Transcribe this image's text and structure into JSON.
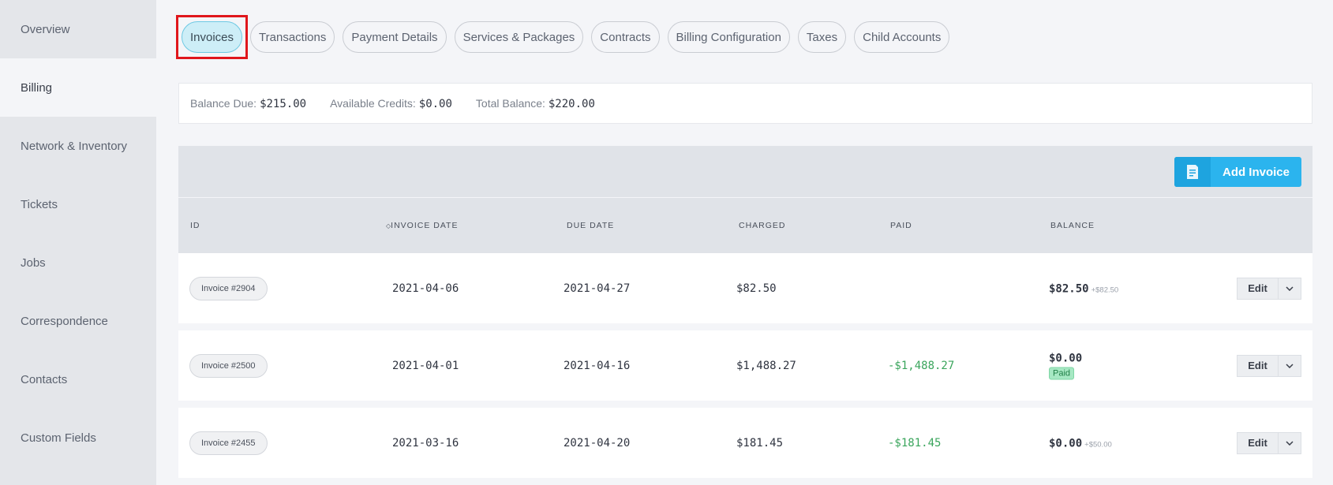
{
  "sidebar": {
    "items": [
      {
        "label": "Overview"
      },
      {
        "label": "Billing"
      },
      {
        "label": "Network & Inventory"
      },
      {
        "label": "Tickets"
      },
      {
        "label": "Jobs"
      },
      {
        "label": "Correspondence"
      },
      {
        "label": "Contacts"
      },
      {
        "label": "Custom Fields"
      }
    ],
    "active": "Billing"
  },
  "tabs": [
    {
      "label": "Invoices"
    },
    {
      "label": "Transactions"
    },
    {
      "label": "Payment Details"
    },
    {
      "label": "Services & Packages"
    },
    {
      "label": "Contracts"
    },
    {
      "label": "Billing Configuration"
    },
    {
      "label": "Taxes"
    },
    {
      "label": "Child Accounts"
    }
  ],
  "balance": {
    "due_label": "Balance Due:",
    "due_value": "$215.00",
    "credits_label": "Available Credits:",
    "credits_value": "$0.00",
    "total_label": "Total Balance:",
    "total_value": "$220.00"
  },
  "toolbar": {
    "add_label": "Add Invoice",
    "add_icon": "invoice-icon"
  },
  "table": {
    "headers": {
      "id": "ID",
      "invoice_date": "INVOICE DATE",
      "due_date": "DUE DATE",
      "charged": "CHARGED",
      "paid": "PAID",
      "balance": "BALANCE"
    },
    "sort_icon": "◇",
    "rows": [
      {
        "id": "Invoice #2904",
        "invoice_date": "2021-04-06",
        "due_date": "2021-04-27",
        "charged": "$82.50",
        "paid": "",
        "balance": "$82.50",
        "balance_sub": "+$82.50",
        "status": ""
      },
      {
        "id": "Invoice #2500",
        "invoice_date": "2021-04-01",
        "due_date": "2021-04-16",
        "charged": "$1,488.27",
        "paid": "-$1,488.27",
        "balance": "$0.00",
        "balance_sub": "",
        "status": "Paid"
      },
      {
        "id": "Invoice #2455",
        "invoice_date": "2021-03-16",
        "due_date": "2021-04-20",
        "charged": "$181.45",
        "paid": "-$181.45",
        "balance": "$0.00",
        "balance_sub": "+$50.00",
        "status": ""
      }
    ],
    "edit_label": "Edit"
  },
  "colors": {
    "accent": "#2bb4ee",
    "paid_green": "#3aa55c",
    "highlight_red": "#e0161c"
  }
}
